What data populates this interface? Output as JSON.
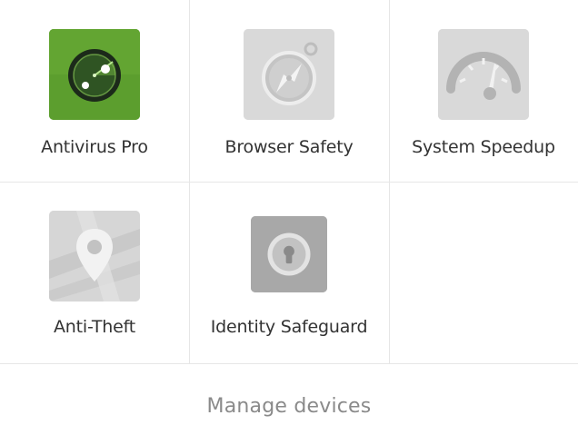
{
  "apps": {
    "antivirus": {
      "label": "Antivirus Pro",
      "icon": "radar-icon",
      "color": "#5c9e2e"
    },
    "browser_safety": {
      "label": "Browser Safety",
      "icon": "compass-icon",
      "color": "#d6d6d6"
    },
    "system_speedup": {
      "label": "System Speedup",
      "icon": "speedometer-icon",
      "color": "#d6d6d6"
    },
    "anti_theft": {
      "label": "Anti-Theft",
      "icon": "map-pin-icon",
      "color": "#d6d6d6"
    },
    "identity_safeguard": {
      "label": "Identity Safeguard",
      "icon": "lock-icon",
      "color": "#a9a9a9"
    }
  },
  "footer": {
    "manage_label": "Manage devices"
  }
}
